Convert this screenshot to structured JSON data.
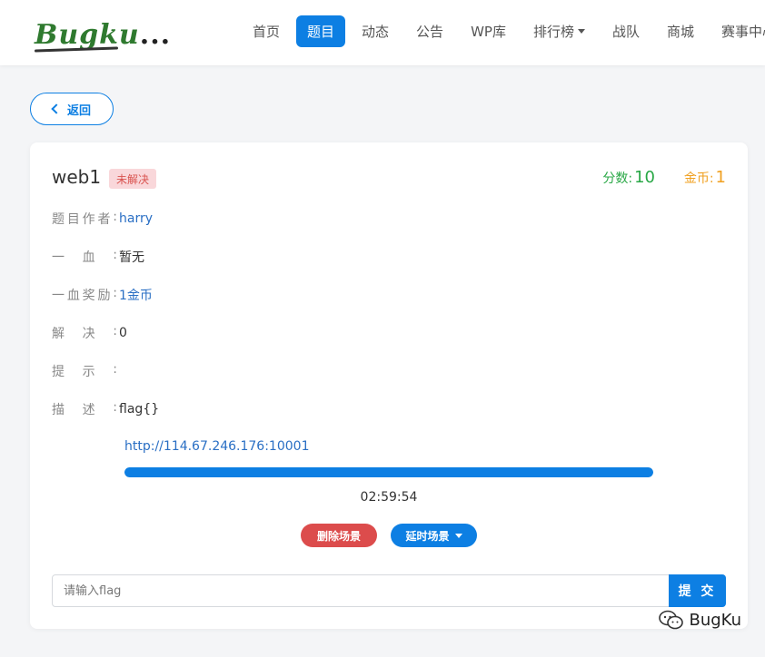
{
  "logo": {
    "text": "Bugku",
    "dots": "..."
  },
  "nav": {
    "items": [
      {
        "label": "首页",
        "active": false
      },
      {
        "label": "题目",
        "active": true
      },
      {
        "label": "动态",
        "active": false
      },
      {
        "label": "公告",
        "active": false
      },
      {
        "label": "WP库",
        "active": false
      },
      {
        "label": "排行榜",
        "active": false,
        "dropdown": true
      },
      {
        "label": "战队",
        "active": false
      },
      {
        "label": "商城",
        "active": false
      },
      {
        "label": "赛事中心",
        "active": false
      }
    ]
  },
  "back": {
    "label": "返回"
  },
  "challenge": {
    "title": "web1",
    "status": "未解决",
    "score_label": "分数:",
    "score_value": "10",
    "coin_label": "金币:",
    "coin_value": "1",
    "fields": [
      {
        "label_chars": [
          "题",
          "目",
          "作",
          "者"
        ],
        "sep": ":",
        "value": "harry",
        "link": true
      },
      {
        "label_chars": [
          "一",
          "血"
        ],
        "sep": ":",
        "value": "暂无",
        "link": false
      },
      {
        "label_chars": [
          "一",
          "血",
          "奖",
          "励"
        ],
        "sep": ":",
        "value": "1金币",
        "link": true
      },
      {
        "label_chars": [
          "解",
          "决"
        ],
        "sep": ":",
        "value": "0",
        "link": false
      },
      {
        "label_chars": [
          "提",
          "示"
        ],
        "sep": ":",
        "value": "",
        "link": false
      },
      {
        "label_chars": [
          "描",
          "述"
        ],
        "sep": ":",
        "value": "flag{}",
        "link": false
      }
    ],
    "url": "http://114.67.246.176:10001",
    "progress_percent": 100,
    "timer": "02:59:54",
    "delete_label": "删除场景",
    "extend_label": "延时场景"
  },
  "submit": {
    "placeholder": "请输入flag",
    "button_label": "提 交"
  },
  "watermark": {
    "text": "BugKu"
  },
  "colors": {
    "primary": "#0d7fe3",
    "danger": "#dc4c4c",
    "success": "#28a745",
    "warning": "#f0a020"
  }
}
